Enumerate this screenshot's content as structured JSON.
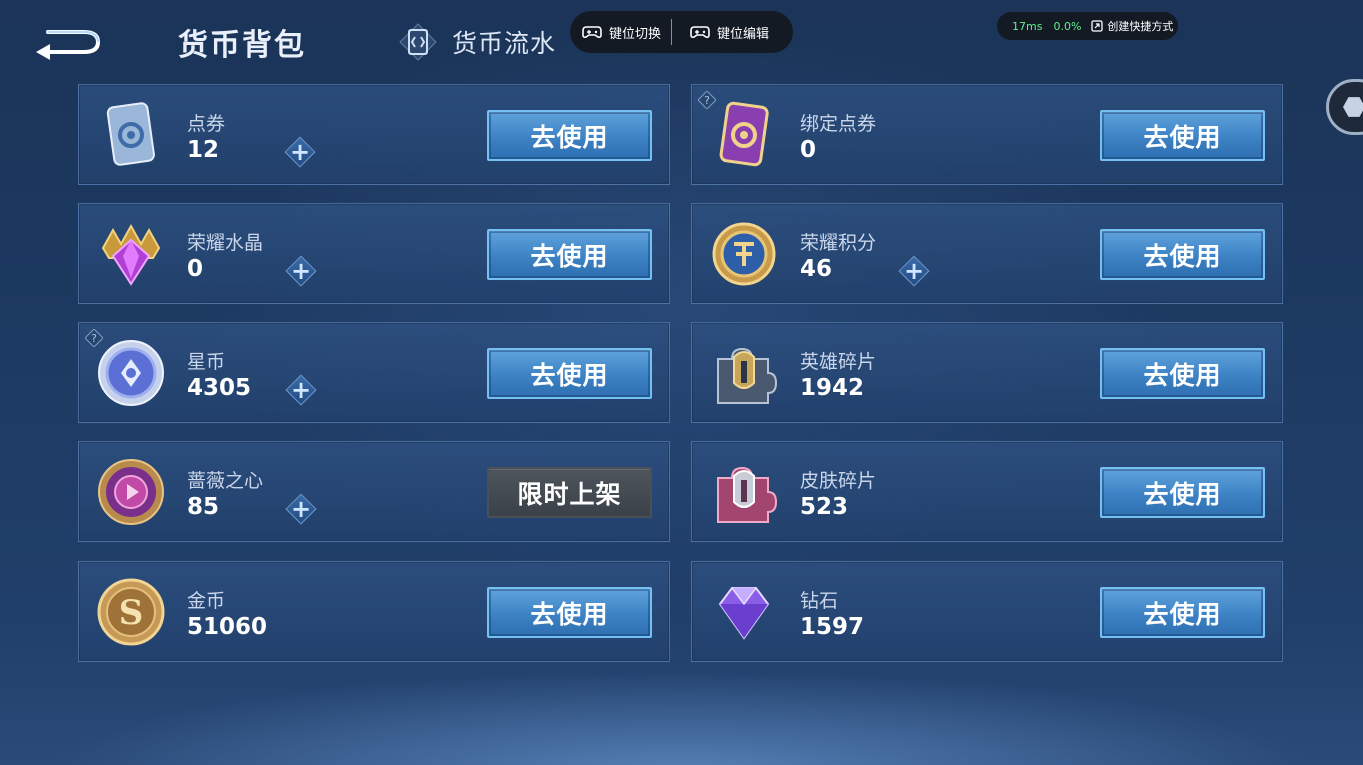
{
  "header": {
    "title": "货币背包",
    "flow_tab": "货币流水"
  },
  "overlay": {
    "key_switch": "键位切换",
    "key_edit": "键位编辑",
    "latency": "17ms",
    "loss": "0.0%",
    "create_shortcut": "创建快捷方式"
  },
  "currencies": [
    {
      "name": "点券",
      "value": "12",
      "button": "去使用",
      "has_plus": true
    },
    {
      "name": "绑定点券",
      "value": "0",
      "button": "去使用",
      "has_plus": false,
      "has_help": true
    },
    {
      "name": "荣耀水晶",
      "value": "0",
      "button": "去使用",
      "has_plus": true
    },
    {
      "name": "荣耀积分",
      "value": "46",
      "button": "去使用",
      "has_plus": true
    },
    {
      "name": "星币",
      "value": "4305",
      "button": "去使用",
      "has_plus": true,
      "has_help": true
    },
    {
      "name": "英雄碎片",
      "value": "1942",
      "button": "去使用",
      "has_plus": false
    },
    {
      "name": "蔷薇之心",
      "value": "85",
      "button": "限时上架",
      "has_plus": true,
      "disabled_style": true
    },
    {
      "name": "皮肤碎片",
      "value": "523",
      "button": "去使用",
      "has_plus": false
    },
    {
      "name": "金币",
      "value": "51060",
      "button": "去使用",
      "has_plus": false
    },
    {
      "name": "钻石",
      "value": "1597",
      "button": "去使用",
      "has_plus": false
    }
  ],
  "icons": {
    "back": "back-arrow-icon",
    "flow": "flow-card-icon",
    "gamepad": "gamepad-icon",
    "shortcut": "shortcut-icon",
    "help": "question-mark-icon",
    "plus": "plus-icon"
  },
  "colors": {
    "background": "#1d3a62",
    "button": "#3d82c4",
    "button_border": "#75c0f2",
    "latency": "#5ff08a"
  }
}
